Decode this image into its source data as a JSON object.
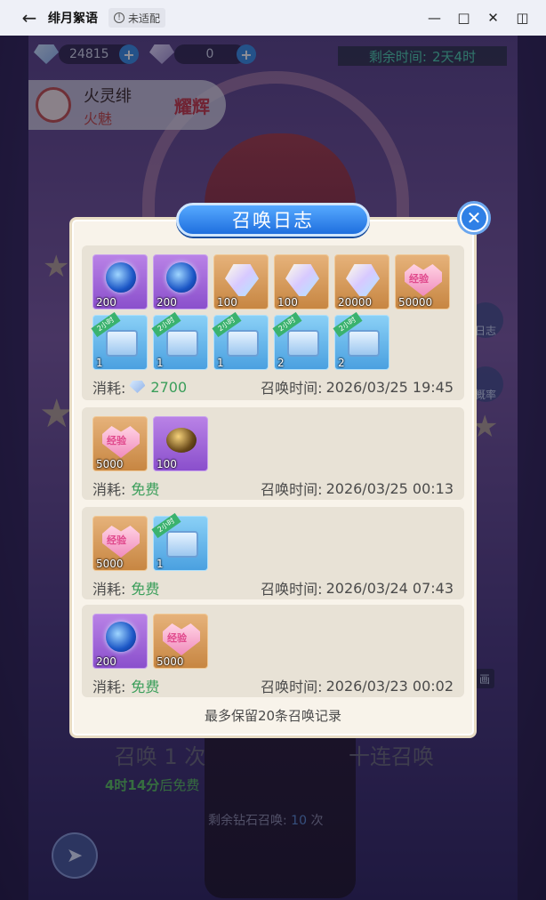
{
  "window": {
    "title": "绯月絮语",
    "badge": "未适配",
    "back_icon": "back-arrow-icon",
    "controls": [
      "minimize-icon",
      "maximize-icon",
      "close-icon",
      "sidebar-icon"
    ]
  },
  "hud": {
    "currency_1": "24815",
    "currency_2": "0",
    "timer_label": "剩余时间:",
    "timer_value": "2天4时"
  },
  "hero": {
    "name": "火灵绯",
    "subtitle": "火魅",
    "tag": "耀辉"
  },
  "side_buttons": {
    "log_label": "日志",
    "rate_label": "概率",
    "extra_label": "画"
  },
  "bottom": {
    "summon_once": "召唤 1 次",
    "summon_ten": "十连召唤",
    "free_time": "4时14分",
    "free_suffix": "后免费",
    "remaining_label": "剩余钻石召唤:",
    "remaining_count": "10",
    "remaining_unit": "次"
  },
  "dialog": {
    "title": "召唤日志",
    "footer": "最多保留20条召唤记录",
    "cost_label": "消耗:",
    "time_label": "召唤时间:",
    "entries": [
      {
        "cost": "2700",
        "cost_icon": "diamond-icon",
        "time": "2026/03/25 19:45",
        "items": [
          {
            "icon": "crystal-orb-icon",
            "qty": "200",
            "bg": "purple"
          },
          {
            "icon": "crystal-orb-icon",
            "qty": "200",
            "bg": "purple"
          },
          {
            "icon": "gem-crystal-icon",
            "qty": "100",
            "bg": "orange"
          },
          {
            "icon": "gem-crystal-icon",
            "qty": "100",
            "bg": "orange"
          },
          {
            "icon": "gem-crystal-icon",
            "qty": "20000",
            "bg": "orange"
          },
          {
            "icon": "heart-exp-icon",
            "qty": "50000",
            "bg": "orange"
          },
          {
            "icon": "treasure-chest-icon",
            "qty": "1",
            "bg": "blue",
            "ribbon": "2小时"
          },
          {
            "icon": "treasure-chest-icon",
            "qty": "1",
            "bg": "blue",
            "ribbon": "2小时"
          },
          {
            "icon": "treasure-chest-icon",
            "qty": "1",
            "bg": "blue",
            "ribbon": "2小时"
          },
          {
            "icon": "treasure-chest-icon",
            "qty": "2",
            "bg": "blue",
            "ribbon": "2小时"
          },
          {
            "icon": "treasure-chest-icon",
            "qty": "2",
            "bg": "blue",
            "ribbon": "2小时"
          }
        ]
      },
      {
        "cost": "免费",
        "time": "2026/03/25 00:13",
        "items": [
          {
            "icon": "heart-exp-icon",
            "qty": "5000",
            "bg": "orange"
          },
          {
            "icon": "golden-bowl-icon",
            "qty": "100",
            "bg": "purple"
          }
        ]
      },
      {
        "cost": "免费",
        "time": "2026/03/24 07:43",
        "items": [
          {
            "icon": "heart-exp-icon",
            "qty": "5000",
            "bg": "orange"
          },
          {
            "icon": "treasure-chest-icon",
            "qty": "1",
            "bg": "blue",
            "ribbon": "2小时"
          }
        ]
      },
      {
        "cost": "免费",
        "time": "2026/03/23 00:02",
        "items": [
          {
            "icon": "crystal-orb-icon",
            "qty": "200",
            "bg": "purple"
          },
          {
            "icon": "heart-exp-icon",
            "qty": "5000",
            "bg": "orange"
          }
        ]
      }
    ],
    "heart_text": "经验",
    "colors": {
      "cost_green": "#3a9e5a",
      "header_blue": "#2f80e6",
      "panel": "#f8f3ea",
      "entry": "#e8e2d6"
    }
  }
}
